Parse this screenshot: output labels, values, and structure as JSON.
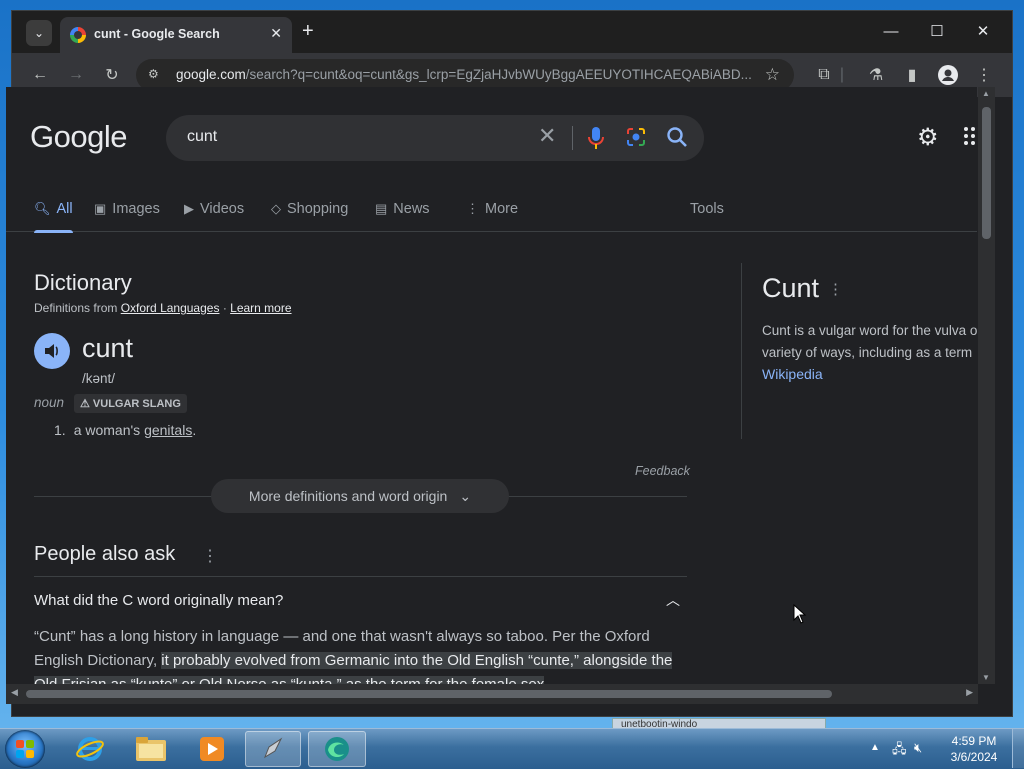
{
  "browser": {
    "tab_title": "cunt - Google Search",
    "url_domain": "google.com",
    "url_rest": "/search?q=cunt&oq=cunt&gs_lcrp=EgZjaHJvbWUyBggAEEUYOTIHCAEQABiABD...",
    "new_tab_label": "+"
  },
  "google": {
    "logo": "Google",
    "query": "cunt",
    "nav_tabs": [
      {
        "label": "All",
        "active": true
      },
      {
        "label": "Images"
      },
      {
        "label": "Videos"
      },
      {
        "label": "Shopping"
      },
      {
        "label": "News"
      },
      {
        "label": "More"
      }
    ],
    "tools": "Tools"
  },
  "dictionary": {
    "title": "Dictionary",
    "from_prefix": "Definitions from",
    "source": "Oxford Languages",
    "separator": "·",
    "learn_more": "Learn more",
    "word": "cunt",
    "phonetic": "/kənt/",
    "pos": "noun",
    "badge": "VULGAR SLANG",
    "def_num": "1.",
    "def_text": "a woman's",
    "def_link": "genitals",
    "def_end": ".",
    "feedback": "Feedback",
    "more_button": "More definitions and word origin"
  },
  "people_also_ask": {
    "title": "People also ask",
    "question": "What did the C word originally mean?",
    "answer_plain": "“Cunt” has a long history in language — and one that wasn't always so taboo. Per the Oxford English Dictionary, ",
    "answer_highlight": "it probably evolved from Germanic into the Old English “cunte,” alongside the Old Frisian as “kunte” or Old Norse as “kunta,” as the term for the female sex"
  },
  "knowledge_panel": {
    "title": "Cunt",
    "line1": "Cunt is a vulgar word for the vulva o",
    "line2": "variety of ways, including as a term",
    "link": "Wikipedia"
  },
  "taskbar": {
    "background_window": "unetbootin-windo",
    "time": "4:59 PM",
    "date": "3/6/2024"
  }
}
